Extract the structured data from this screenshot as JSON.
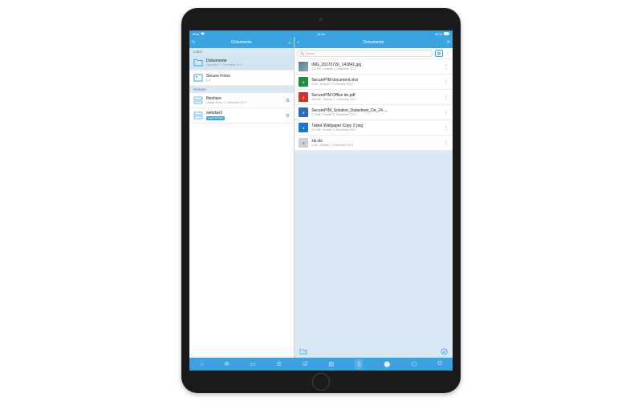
{
  "status_bar": {
    "device": "iPad",
    "wifi_icon": "wifi-icon",
    "time": "14:51",
    "battery_pct": "93 %",
    "battery_icon": "battery-icon"
  },
  "left_pane": {
    "title": "Dokumente",
    "sections": {
      "local_label": "Lokal",
      "remote_label": "Remote"
    },
    "local": [
      {
        "title": "Dokumente",
        "sub": "Geändert: 1. Dezember 2017",
        "icon": "folder-icon",
        "selected": true
      },
      {
        "title": "Secure Fotos",
        "sub": "k.A.",
        "icon": "photos-icon",
        "selected": false
      }
    ],
    "remote": [
      {
        "title": "fileshare",
        "sub": "Letzter Sync: 1. Dezember 2017",
        "icon": "server-icon",
        "gear": true
      },
      {
        "title": "webdav3",
        "badge": "Login benötigt",
        "icon": "server-icon",
        "gear": true
      }
    ]
  },
  "right_pane": {
    "title": "Dokumente",
    "back_icon": "chevron-left-icon",
    "refresh_icon": "refresh-icon",
    "search_placeholder": "Suche",
    "grid_icon": "grid-icon",
    "more_icon": "more-icon",
    "files": [
      {
        "name": "IMG_20170720_141841.jpg",
        "meta": "412 KB · Erstellt: 1. Dezember 2017",
        "type": "img"
      },
      {
        "name": "SecurePIM document.xlsx",
        "meta": "9 KB · Erstellt: 1. Dezember 2017",
        "type": "xlsx"
      },
      {
        "name": "SecurePIM Office de.pdf",
        "meta": "486 KB · Erstellt: 1. Dezember 2017",
        "type": "pdf"
      },
      {
        "name": "SecurePIM_Solution_Datasheet_De_24....",
        "meta": "1.0 MB · Erstellt: 1. Dezember 2017",
        "type": "xlsx2"
      },
      {
        "name": "Tablet Wallpaper Copy 2.png",
        "meta": "8.0 MB · Erstellt: 1. Dezember 2017",
        "type": "png"
      },
      {
        "name": "xls.xls",
        "meta": "1 KB · Erstellt: 1. Dezember 2017",
        "type": "xls"
      }
    ],
    "footer": {
      "new_folder_icon": "new-folder-icon",
      "select_icon": "circle-check-icon"
    }
  },
  "tab_bar": {
    "tabs": [
      {
        "name": "key-icon"
      },
      {
        "name": "mail-icon"
      },
      {
        "name": "calendar-icon"
      },
      {
        "name": "contacts-icon"
      },
      {
        "name": "tasks-icon"
      },
      {
        "name": "notes-icon"
      },
      {
        "name": "documents-icon",
        "active": true
      },
      {
        "name": "browser-icon"
      },
      {
        "name": "camera-icon"
      },
      {
        "name": "settings-icon"
      }
    ]
  }
}
